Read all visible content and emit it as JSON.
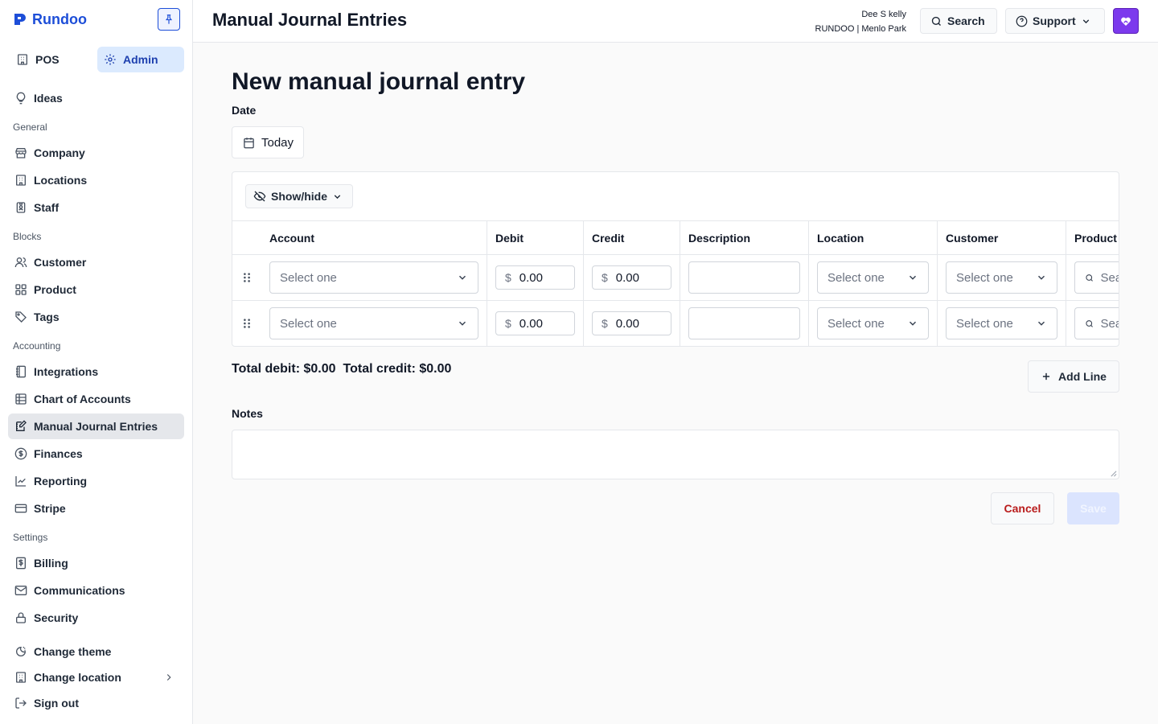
{
  "brand": {
    "name": "Rundoo",
    "accent": "#1d4ed8"
  },
  "sidebar": {
    "mode_tabs": [
      {
        "label": "POS",
        "icon": "building-icon"
      },
      {
        "label": "Admin",
        "icon": "gear-icon",
        "active": true
      }
    ],
    "ideas": {
      "label": "Ideas",
      "icon": "lightbulb-icon"
    },
    "sections": {
      "general": "General",
      "blocks": "Blocks",
      "accounting": "Accounting",
      "settings": "Settings"
    },
    "items": {
      "company": "Company",
      "locations": "Locations",
      "staff": "Staff",
      "customer": "Customer",
      "product": "Product",
      "tags": "Tags",
      "integrations": "Integrations",
      "chart_of_accounts": "Chart of Accounts",
      "manual_journal_entries": "Manual Journal Entries",
      "finances": "Finances",
      "reporting": "Reporting",
      "stripe": "Stripe",
      "billing": "Billing",
      "communications": "Communications",
      "security": "Security",
      "change_theme": "Change theme",
      "change_location": "Change location",
      "sign_out": "Sign out"
    },
    "active_item": "Manual Journal Entries"
  },
  "header": {
    "title": "Manual Journal Entries",
    "user_name": "Dee S kelly",
    "user_org": "RUNDOO | Menlo Park",
    "search_label": "Search",
    "support_label": "Support"
  },
  "form": {
    "heading": "New manual journal entry",
    "date_label": "Date",
    "date_value": "Today",
    "show_hide_label": "Show/hide",
    "columns": [
      "Account",
      "Debit",
      "Credit",
      "Description",
      "Location",
      "Customer",
      "Product"
    ],
    "rows": [
      {
        "account": "Select one",
        "debit_currency": "$",
        "debit": "0.00",
        "credit_currency": "$",
        "credit": "0.00",
        "description": "",
        "location": "Select one",
        "customer": "Select one",
        "product_placeholder": "Search"
      },
      {
        "account": "Select one",
        "debit_currency": "$",
        "debit": "0.00",
        "credit_currency": "$",
        "credit": "0.00",
        "description": "",
        "location": "Select one",
        "customer": "Select one",
        "product_placeholder": "Search"
      }
    ],
    "total_debit": "Total debit: $0.00",
    "total_credit": "Total credit: $0.00",
    "add_line_label": "Add Line",
    "notes_label": "Notes",
    "notes_value": "",
    "cancel_label": "Cancel",
    "save_label": "Save"
  },
  "colors": {
    "cancel": "#b91c1c",
    "save_disabled_bg": "#dbe4fe",
    "active_nav_bg": "#e5e7eb",
    "admin_tab_bg": "#dbeafe",
    "avatar_bg": "#7c3aed"
  }
}
